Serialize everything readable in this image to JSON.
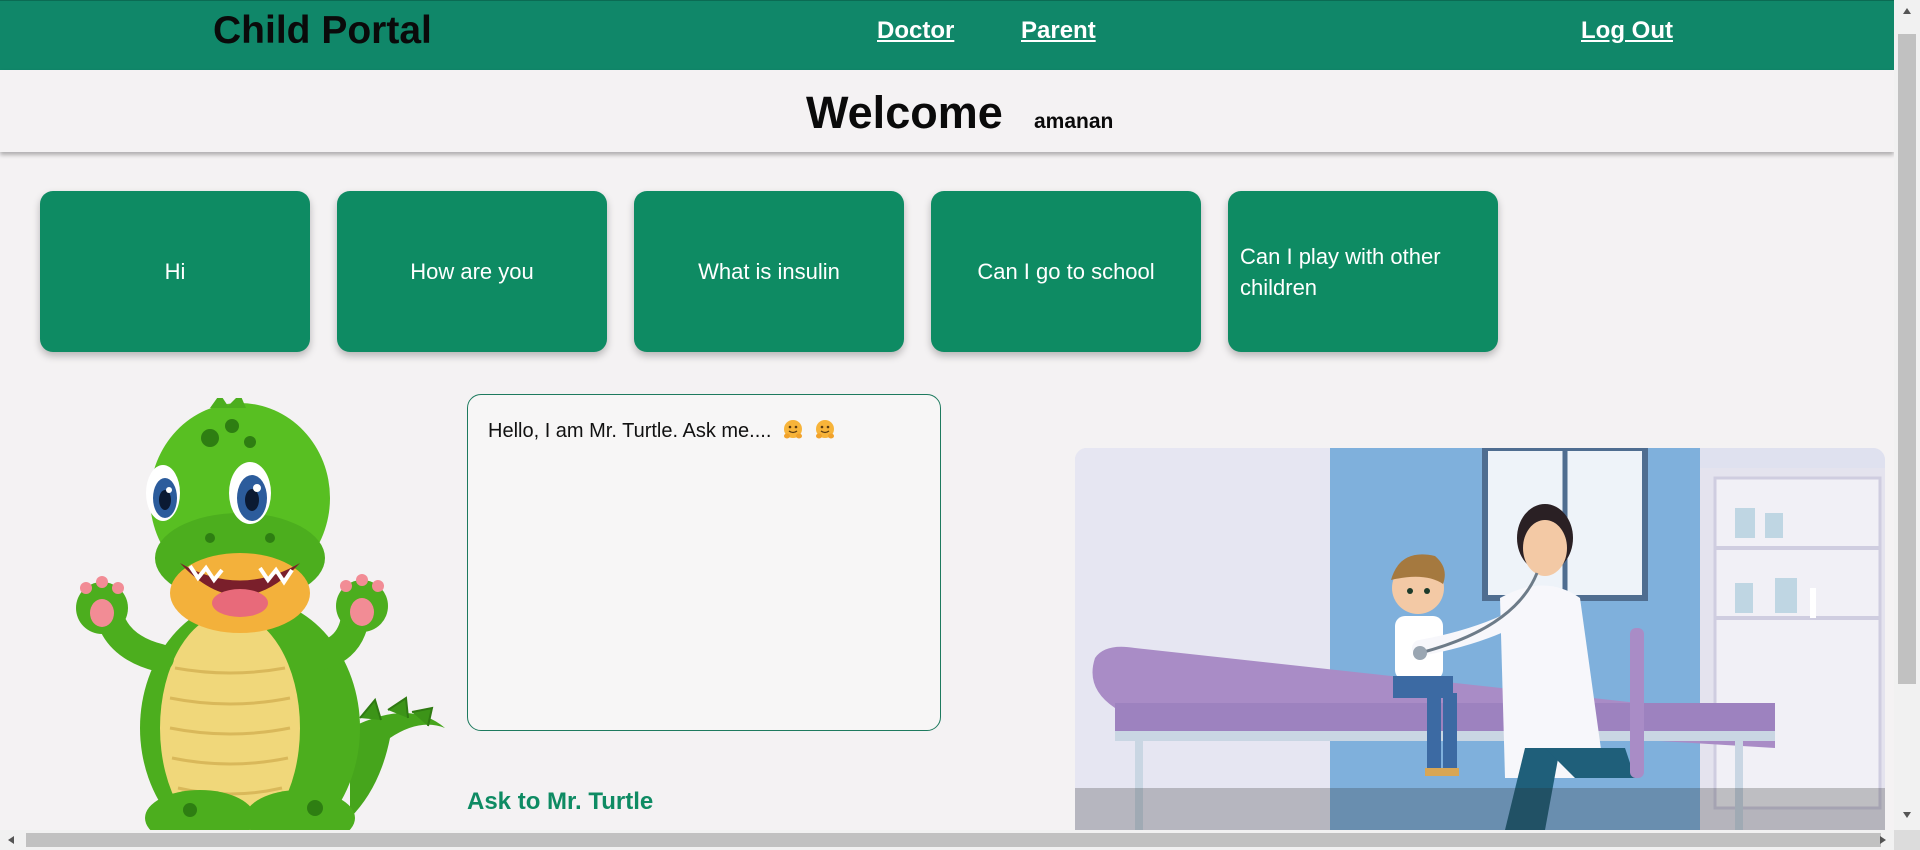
{
  "nav": {
    "brand": "Child Portal",
    "doctor_label": "Doctor",
    "parent_label": "Parent",
    "logout_label": "Log Out"
  },
  "welcome": {
    "title": "Welcome",
    "username": "amanan"
  },
  "quick_questions": [
    "Hi",
    "How are you",
    "What is insulin",
    "Can I go to school",
    "Can I play with other children"
  ],
  "chat": {
    "message": "Hello, I am Mr. Turtle. Ask me....",
    "emoji": [
      "hugging-face-emoji",
      "hugging-face-emoji"
    ]
  },
  "ask_label": "Ask to Mr. Turtle",
  "colors": {
    "primary": "#108769",
    "card": "#0e8b63",
    "background": "#f4f2f3"
  }
}
